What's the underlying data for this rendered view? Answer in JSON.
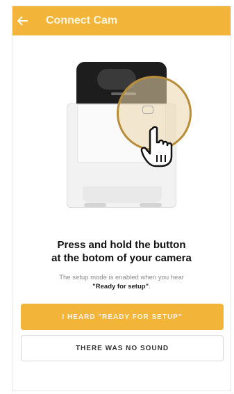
{
  "app": {
    "title": "Connect Cam",
    "accent_color": "#f2b53a"
  },
  "icons": {
    "back": "arrow-left-icon",
    "hand": "hand-pointer-icon"
  },
  "instructions": {
    "headline_line1": "Press and hold the button",
    "headline_line2": "at the botom of your camera",
    "sub_text": "The setup mode is enabled when you hear",
    "sub_emphasis": "\"Ready for setup\"",
    "sub_end": "."
  },
  "actions": {
    "primary_label": "I HEARD \"READY FOR SETUP\"",
    "secondary_label": "THERE WAS NO SOUND"
  }
}
